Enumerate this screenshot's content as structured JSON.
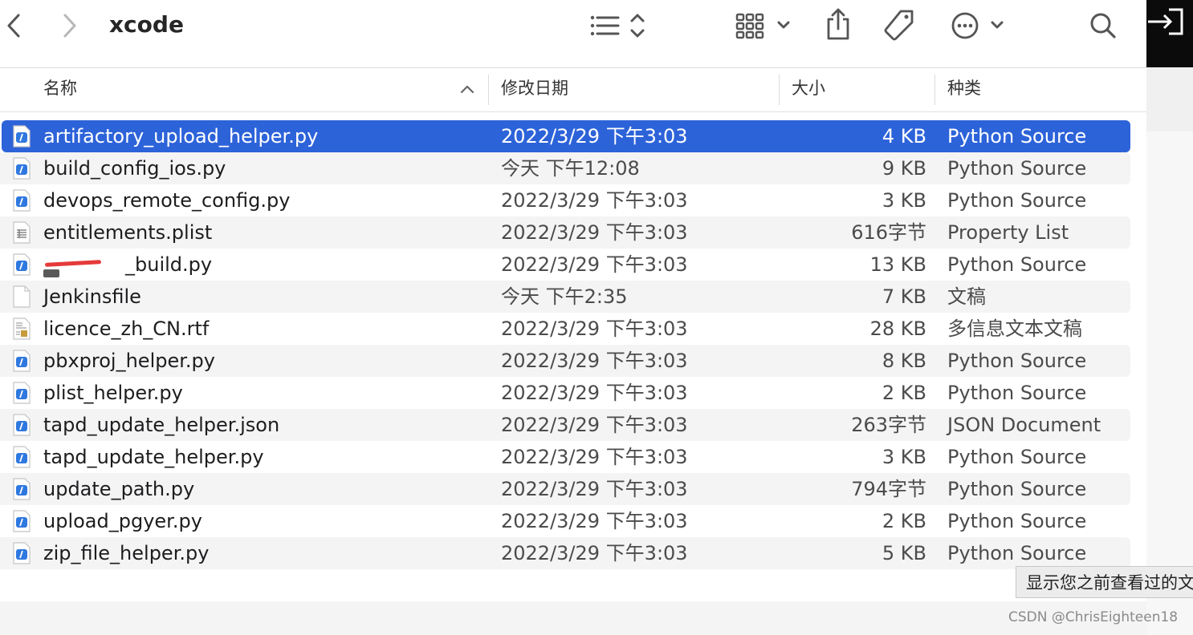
{
  "window": {
    "title": "xcode"
  },
  "toolbar": {
    "back_icon": "chevron-left-icon",
    "forward_icon": "chevron-right-icon",
    "list_view_icon": "list-view-icon",
    "group_icon": "icon-grid-icon",
    "share_icon": "share-icon",
    "tag_icon": "tag-icon",
    "more_icon": "ellipsis-circle-icon",
    "search_icon": "search-icon"
  },
  "columns": {
    "name": "名称",
    "date": "修改日期",
    "size": "大小",
    "kind": "种类"
  },
  "files": [
    {
      "name": "artifactory_upload_helper.py",
      "date": "2022/3/29 下午3:03",
      "size": "4 KB",
      "kind": "Python Source",
      "icon": "python-file-icon",
      "selected": true
    },
    {
      "name": "build_config_ios.py",
      "date": "今天 下午12:08",
      "size": "9 KB",
      "kind": "Python Source",
      "icon": "python-file-icon"
    },
    {
      "name": "devops_remote_config.py",
      "date": "2022/3/29 下午3:03",
      "size": "3 KB",
      "kind": "Python Source",
      "icon": "python-file-icon"
    },
    {
      "name": "entitlements.plist",
      "date": "2022/3/29 下午3:03",
      "size": "616字节",
      "kind": "Property List",
      "icon": "plist-file-icon"
    },
    {
      "name": "_build.py",
      "date": "2022/3/29 下午3:03",
      "size": "13 KB",
      "kind": "Python Source",
      "icon": "python-file-icon"
    },
    {
      "name": "Jenkinsfile",
      "date": "今天 下午2:35",
      "size": "7 KB",
      "kind": "文稿",
      "icon": "blank-file-icon"
    },
    {
      "name": "licence_zh_CN.rtf",
      "date": "2022/3/29 下午3:03",
      "size": "28 KB",
      "kind": "多信息文本文稿",
      "icon": "rtf-file-icon"
    },
    {
      "name": "pbxproj_helper.py",
      "date": "2022/3/29 下午3:03",
      "size": "8 KB",
      "kind": "Python Source",
      "icon": "python-file-icon"
    },
    {
      "name": "plist_helper.py",
      "date": "2022/3/29 下午3:03",
      "size": "2 KB",
      "kind": "Python Source",
      "icon": "python-file-icon"
    },
    {
      "name": "tapd_update_helper.json",
      "date": "2022/3/29 下午3:03",
      "size": "263字节",
      "kind": "JSON Document",
      "icon": "json-file-icon"
    },
    {
      "name": "tapd_update_helper.py",
      "date": "2022/3/29 下午3:03",
      "size": "3 KB",
      "kind": "Python Source",
      "icon": "python-file-icon"
    },
    {
      "name": "update_path.py",
      "date": "2022/3/29 下午3:03",
      "size": "794字节",
      "kind": "Python Source",
      "icon": "python-file-icon"
    },
    {
      "name": "upload_pgyer.py",
      "date": "2022/3/29 下午3:03",
      "size": "2 KB",
      "kind": "Python Source",
      "icon": "python-file-icon"
    },
    {
      "name": "zip_file_helper.py",
      "date": "2022/3/29 下午3:03",
      "size": "5 KB",
      "kind": "Python Source",
      "icon": "python-file-icon"
    }
  ],
  "tooltip": "显示您之前查看过的文",
  "watermark": "CSDN @ChrisEighteen18",
  "colors": {
    "selection": "#2d63d9",
    "alt_row": "#f4f4f5",
    "python_icon": "#2f78e0"
  }
}
